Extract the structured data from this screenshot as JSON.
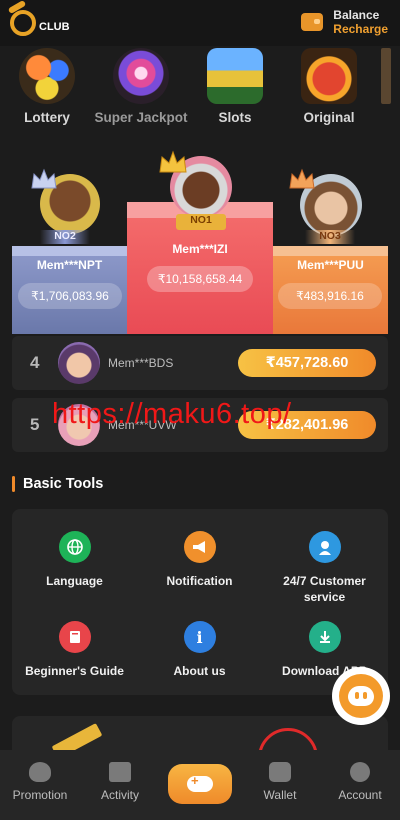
{
  "header": {
    "logo_text": "CLUB",
    "balance_label": "Balance",
    "recharge_label": "Recharge"
  },
  "categories": [
    {
      "label": "Lottery",
      "icon": "lottery-balls-icon"
    },
    {
      "label": "Super Jackpot",
      "icon": "jackpot-wheel-icon"
    },
    {
      "label": "Slots",
      "icon": "slot-machine-icon"
    },
    {
      "label": "Original",
      "icon": "original-game-icon"
    }
  ],
  "podium": {
    "first": {
      "rank": "NO1",
      "name": "Mem***IZI",
      "amount": "₹10,158,658.44"
    },
    "second": {
      "rank": "NO2",
      "name": "Mem***NPT",
      "amount": "₹1,706,083.96"
    },
    "third": {
      "rank": "NO3",
      "name": "Mem***PUU",
      "amount": "₹483,916.16"
    }
  },
  "ranks": [
    {
      "position": "4",
      "name": "Mem***BDS",
      "amount": "₹457,728.60"
    },
    {
      "position": "5",
      "name": "Mem***UVW",
      "amount": "₹282,401.96"
    }
  ],
  "watermark": "https://maku6.top/",
  "basic_tools": {
    "title": "Basic Tools",
    "items": [
      {
        "label": "Language",
        "icon": "globe-icon"
      },
      {
        "label": "Notification",
        "icon": "megaphone-icon"
      },
      {
        "label": "24/7 Customer service",
        "icon": "support-agent-icon"
      },
      {
        "label": "Beginner's Guide",
        "icon": "book-icon"
      },
      {
        "label": "About us",
        "icon": "info-icon"
      },
      {
        "label": "Download APP",
        "icon": "download-icon"
      }
    ]
  },
  "tabbar": {
    "promotion": "Promotion",
    "activity": "Activity",
    "wallet": "Wallet",
    "account": "Account"
  },
  "colors": {
    "accent": "#f08a2a",
    "background": "#1c1c1c",
    "card": "#262626"
  }
}
